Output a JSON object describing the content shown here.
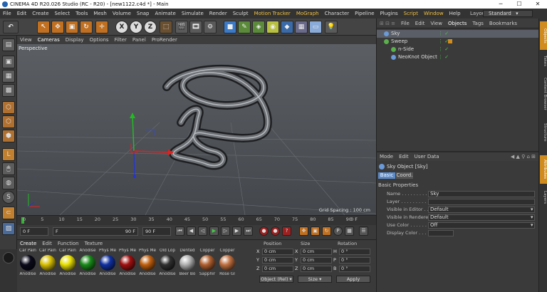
{
  "window": {
    "title": "CINEMA 4D R20.026 Studio (RC - R20) - [new1122.c4d *] - Main",
    "minimize": "─",
    "maximize": "☐",
    "close": "✕"
  },
  "menubar": {
    "items": [
      "File",
      "Edit",
      "Create",
      "Select",
      "Tools",
      "Mesh",
      "Volume",
      "Snap",
      "Animate",
      "Simulate",
      "Render",
      "Sculpt",
      "Motion Tracker",
      "MoGraph",
      "Character",
      "Pipeline",
      "Plugins",
      "Script",
      "Window",
      "Help"
    ],
    "layout_label": "Layout:",
    "layout_value": "Standard"
  },
  "toolbar": {
    "axis_x": "X",
    "axis_y": "Y",
    "axis_z": "Z"
  },
  "viewport": {
    "menu": [
      "View",
      "Cameras",
      "Display",
      "Options",
      "Filter",
      "Panel",
      "ProRender"
    ],
    "label": "Perspective",
    "grid_spacing": "Grid Spacing : 100 cm"
  },
  "timeline": {
    "ticks": [
      "0",
      "5",
      "10",
      "15",
      "20",
      "25",
      "30",
      "35",
      "40",
      "45",
      "50",
      "55",
      "60",
      "65",
      "70",
      "75",
      "80",
      "85",
      "90"
    ],
    "frame_end": "0 F"
  },
  "playback": {
    "start": "0 F",
    "current": "F",
    "end_field": "90 F",
    "end_field2": "90 F"
  },
  "materials": {
    "tabs": [
      "Create",
      "Edit",
      "Function",
      "Texture"
    ],
    "row1": [
      {
        "name": "Car Pain",
        "color": "#0a0a1a"
      },
      {
        "name": "Car Pain",
        "color": "#d8c000"
      },
      {
        "name": "Car Pain",
        "color": "#e8e000"
      },
      {
        "name": "Anodise",
        "color": "#1a8a1a"
      },
      {
        "name": "Phys Me",
        "color": "#1030a0"
      },
      {
        "name": "Phys Me",
        "color": "#a01010"
      },
      {
        "name": "Phys Me",
        "color": "#c06010"
      },
      {
        "name": "Old Lop",
        "color": "#303030"
      },
      {
        "name": "Dented",
        "color": "#b0b0b0"
      },
      {
        "name": "Copper",
        "color": "#b06030"
      },
      {
        "name": "Copper",
        "color": "#c07040"
      }
    ],
    "row2": [
      "Anodise",
      "Anodise",
      "Anodise",
      "Anodise",
      "Anodise",
      "Anodise",
      "Anodise",
      "Anodise",
      "Beer Bo",
      "Sapphir",
      "Rose Gl"
    ]
  },
  "coordinates": {
    "headers": {
      "position": "Position",
      "size": "Size",
      "rotation": "Rotation"
    },
    "rows": [
      {
        "axis": "X",
        "pos": "0 cm",
        "size": "0 cm",
        "rot_axis": "H",
        "rot": "0 °"
      },
      {
        "axis": "Y",
        "pos": "0 cm",
        "size": "0 cm",
        "rot_axis": "P",
        "rot": "0 °"
      },
      {
        "axis": "Z",
        "pos": "0 cm",
        "size": "0 cm",
        "rot_axis": "B",
        "rot": "0 °"
      }
    ],
    "mode_object": "Object (Rel) ▾",
    "mode_size": "Size ▾",
    "apply": "Apply"
  },
  "objects": {
    "menu": [
      "File",
      "Edit",
      "View",
      "Objects",
      "Tags",
      "Bookmarks"
    ],
    "items": [
      {
        "name": "Sky",
        "indent": 0,
        "selected": true
      },
      {
        "name": "Sweep",
        "indent": 0,
        "selected": false
      },
      {
        "name": "n-Side",
        "indent": 1,
        "selected": false
      },
      {
        "name": "NeoKnot Object",
        "indent": 1,
        "selected": false
      }
    ]
  },
  "attributes": {
    "menu": [
      "Mode",
      "Edit",
      "User Data"
    ],
    "object_title": "Sky Object [Sky]",
    "tabs": [
      "Basic",
      "Coord."
    ],
    "section": "Basic Properties",
    "fields": [
      {
        "label": "Name . . . . . . . . . . .",
        "value": "Sky"
      },
      {
        "label": "Layer . . . . . . . . . . .",
        "value": ""
      },
      {
        "label": "Visible in Editor . . .",
        "value": "Default"
      },
      {
        "label": "Visible in Renderer",
        "value": "Default"
      },
      {
        "label": "Use Color . . . . . . .",
        "value": "Off"
      },
      {
        "label": "Display Color . . . .",
        "value": ""
      }
    ]
  },
  "sidetabs": [
    "Objects",
    "Takes",
    "Content Browser",
    "Structure",
    "Attributes",
    "Layers"
  ],
  "colors": {
    "accent": "#d08c1e",
    "selection": "#5a5e66",
    "highlight_menu": "#f0c040"
  }
}
